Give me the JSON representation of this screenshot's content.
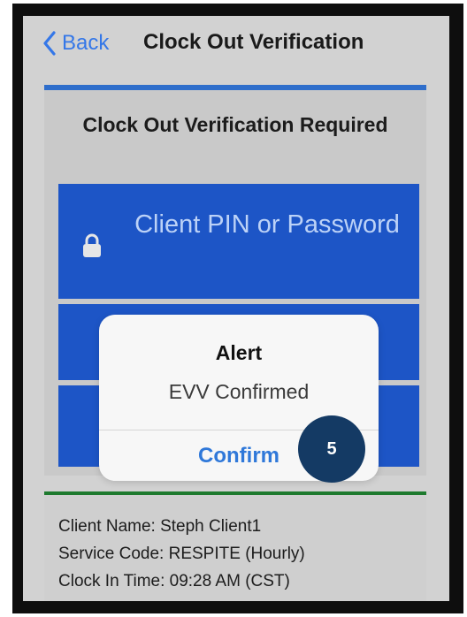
{
  "navbar": {
    "back_label": "Back",
    "title": "Clock Out Verification",
    "accent_color": "#3477e8"
  },
  "verification": {
    "heading": "Clock Out Verification Required",
    "pin_placeholder": "Client PIN or Password",
    "pin_icon": "lock-icon",
    "block_color": "#1d55c6"
  },
  "alert": {
    "title": "Alert",
    "message": "EVV Confirmed",
    "confirm_label": "Confirm"
  },
  "step_badge": {
    "number": "5",
    "color": "#143a64"
  },
  "visit_info": {
    "client_name": "Client Name: Steph Client1",
    "service_code": "Service Code: RESPITE (Hourly)",
    "clock_in_time": "Clock In Time: 09:28 AM (CST)"
  }
}
